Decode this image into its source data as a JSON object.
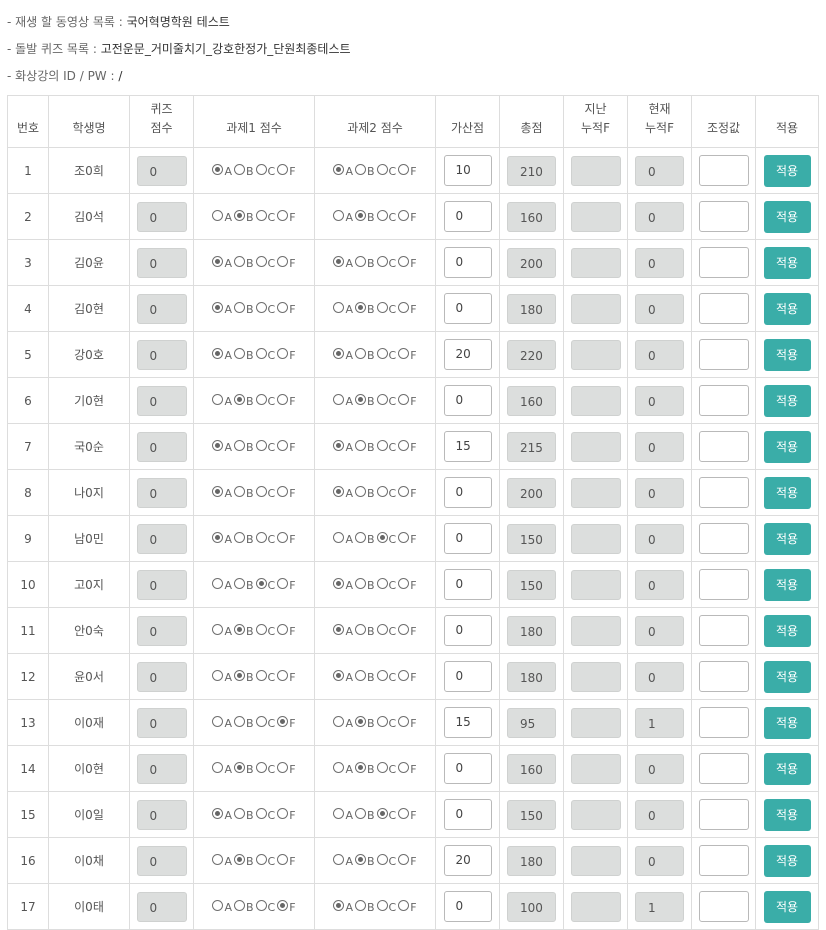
{
  "info": {
    "video_label": "- 재생 할 동영상 목록 : ",
    "video_value": "국어혁명학원 테스트",
    "quiz_label": "- 돌발 퀴즈 목록 : ",
    "quiz_value": "고전운문_거미줄치기_강호한정가_단원최종테스트",
    "live_label": "- 화상강의 ID / PW : ",
    "live_value": "/"
  },
  "headers": {
    "no": "번호",
    "name": "학생명",
    "quiz_l1": "퀴즈",
    "quiz_l2": "점수",
    "task1": "과제1 점수",
    "task2": "과제2 점수",
    "bonus": "가산점",
    "total": "총점",
    "prev_l1": "지난",
    "prev_l2": "누적F",
    "curr_l1": "현재",
    "curr_l2": "누적F",
    "adjust": "조정값",
    "apply": "적용"
  },
  "grade_options": [
    "A",
    "B",
    "C",
    "F"
  ],
  "apply_label": "적용",
  "rows": [
    {
      "no": "1",
      "name": "조0희",
      "quiz": "0",
      "task1": "A",
      "task2": "A",
      "bonus": "10",
      "total": "210",
      "prev": "",
      "curr": "0",
      "adjust": ""
    },
    {
      "no": "2",
      "name": "김0석",
      "quiz": "0",
      "task1": "B",
      "task2": "B",
      "bonus": "0",
      "total": "160",
      "prev": "",
      "curr": "0",
      "adjust": ""
    },
    {
      "no": "3",
      "name": "김0윤",
      "quiz": "0",
      "task1": "A",
      "task2": "A",
      "bonus": "0",
      "total": "200",
      "prev": "",
      "curr": "0",
      "adjust": ""
    },
    {
      "no": "4",
      "name": "김0현",
      "quiz": "0",
      "task1": "A",
      "task2": "B",
      "bonus": "0",
      "total": "180",
      "prev": "",
      "curr": "0",
      "adjust": ""
    },
    {
      "no": "5",
      "name": "강0호",
      "quiz": "0",
      "task1": "A",
      "task2": "A",
      "bonus": "20",
      "total": "220",
      "prev": "",
      "curr": "0",
      "adjust": ""
    },
    {
      "no": "6",
      "name": "기0현",
      "quiz": "0",
      "task1": "B",
      "task2": "B",
      "bonus": "0",
      "total": "160",
      "prev": "",
      "curr": "0",
      "adjust": ""
    },
    {
      "no": "7",
      "name": "국0순",
      "quiz": "0",
      "task1": "A",
      "task2": "A",
      "bonus": "15",
      "total": "215",
      "prev": "",
      "curr": "0",
      "adjust": ""
    },
    {
      "no": "8",
      "name": "나0지",
      "quiz": "0",
      "task1": "A",
      "task2": "A",
      "bonus": "0",
      "total": "200",
      "prev": "",
      "curr": "0",
      "adjust": ""
    },
    {
      "no": "9",
      "name": "남0민",
      "quiz": "0",
      "task1": "A",
      "task2": "C",
      "bonus": "0",
      "total": "150",
      "prev": "",
      "curr": "0",
      "adjust": ""
    },
    {
      "no": "10",
      "name": "고0지",
      "quiz": "0",
      "task1": "C",
      "task2": "A",
      "bonus": "0",
      "total": "150",
      "prev": "",
      "curr": "0",
      "adjust": ""
    },
    {
      "no": "11",
      "name": "안0숙",
      "quiz": "0",
      "task1": "B",
      "task2": "A",
      "bonus": "0",
      "total": "180",
      "prev": "",
      "curr": "0",
      "adjust": ""
    },
    {
      "no": "12",
      "name": "윤0서",
      "quiz": "0",
      "task1": "B",
      "task2": "A",
      "bonus": "0",
      "total": "180",
      "prev": "",
      "curr": "0",
      "adjust": ""
    },
    {
      "no": "13",
      "name": "이0재",
      "quiz": "0",
      "task1": "F",
      "task2": "B",
      "bonus": "15",
      "total": "95",
      "prev": "",
      "curr": "1",
      "adjust": ""
    },
    {
      "no": "14",
      "name": "이0현",
      "quiz": "0",
      "task1": "B",
      "task2": "B",
      "bonus": "0",
      "total": "160",
      "prev": "",
      "curr": "0",
      "adjust": ""
    },
    {
      "no": "15",
      "name": "이0일",
      "quiz": "0",
      "task1": "A",
      "task2": "C",
      "bonus": "0",
      "total": "150",
      "prev": "",
      "curr": "0",
      "adjust": ""
    },
    {
      "no": "16",
      "name": "이0채",
      "quiz": "0",
      "task1": "B",
      "task2": "B",
      "bonus": "20",
      "total": "180",
      "prev": "",
      "curr": "0",
      "adjust": ""
    },
    {
      "no": "17",
      "name": "이0태",
      "quiz": "0",
      "task1": "F",
      "task2": "A",
      "bonus": "0",
      "total": "100",
      "prev": "",
      "curr": "1",
      "adjust": ""
    }
  ]
}
